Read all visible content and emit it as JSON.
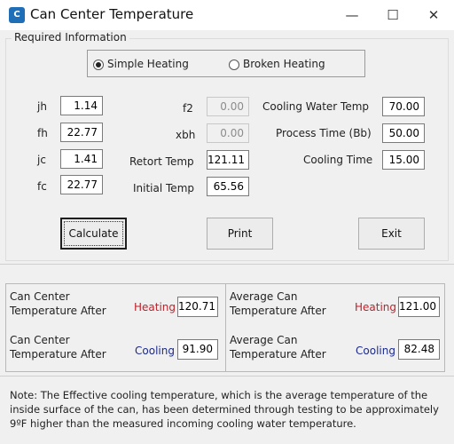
{
  "window": {
    "title": "Can Center Temperature",
    "app_icon_text": "C",
    "minimize_glyph": "—",
    "maximize_glyph": "☐",
    "close_glyph": "✕"
  },
  "required_info": {
    "group_label": "Required Information",
    "heating_mode": {
      "options": [
        "Simple Heating",
        "Broken Heating"
      ],
      "selected": "Simple Heating"
    }
  },
  "params": {
    "jh": {
      "label": "jh",
      "value": "1.14"
    },
    "fh": {
      "label": "fh",
      "value": "22.77"
    },
    "jc": {
      "label": "jc",
      "value": "1.41"
    },
    "fc": {
      "label": "fc",
      "value": "22.77"
    },
    "f2": {
      "label": "f2",
      "value": "0.00"
    },
    "xbh": {
      "label": "xbh",
      "value": "0.00"
    },
    "retort_temp": {
      "label": "Retort Temp",
      "value": "121.11"
    },
    "initial_temp": {
      "label": "Initial Temp",
      "value": "65.56"
    },
    "cooling_water_temp": {
      "label": "Cooling Water Temp",
      "value": "70.00"
    },
    "process_time": {
      "label": "Process Time (Bb)",
      "value": "50.00"
    },
    "cooling_time": {
      "label": "Cooling Time",
      "value": "15.00"
    }
  },
  "buttons": {
    "calculate": "Calculate",
    "print": "Print",
    "exit": "Exit"
  },
  "results": {
    "center_heating": {
      "label_line1": "Can Center",
      "label_line2": "Temperature After",
      "phase": "Heating",
      "value": "120.71"
    },
    "average_heating": {
      "label_line1": "Average Can",
      "label_line2": "Temperature After",
      "phase": "Heating",
      "value": "121.00"
    },
    "center_cooling": {
      "label_line1": "Can Center",
      "label_line2": "Temperature After",
      "phase": "Cooling",
      "value": "91.90"
    },
    "average_cooling": {
      "label_line1": "Average Can",
      "label_line2": "Temperature After",
      "phase": "Cooling",
      "value": "82.48"
    }
  },
  "note": {
    "line1": "Note: The Effective cooling temperature, which is the average temperature of the",
    "line2": "inside surface of the can, has been determined through testing to be approximately",
    "line3": "9ºF higher than the measured incoming cooling water temperature."
  },
  "colors": {
    "heating": "#c0202a",
    "cooling": "#1c2a8a",
    "app_icon": "#1e6fb8"
  }
}
